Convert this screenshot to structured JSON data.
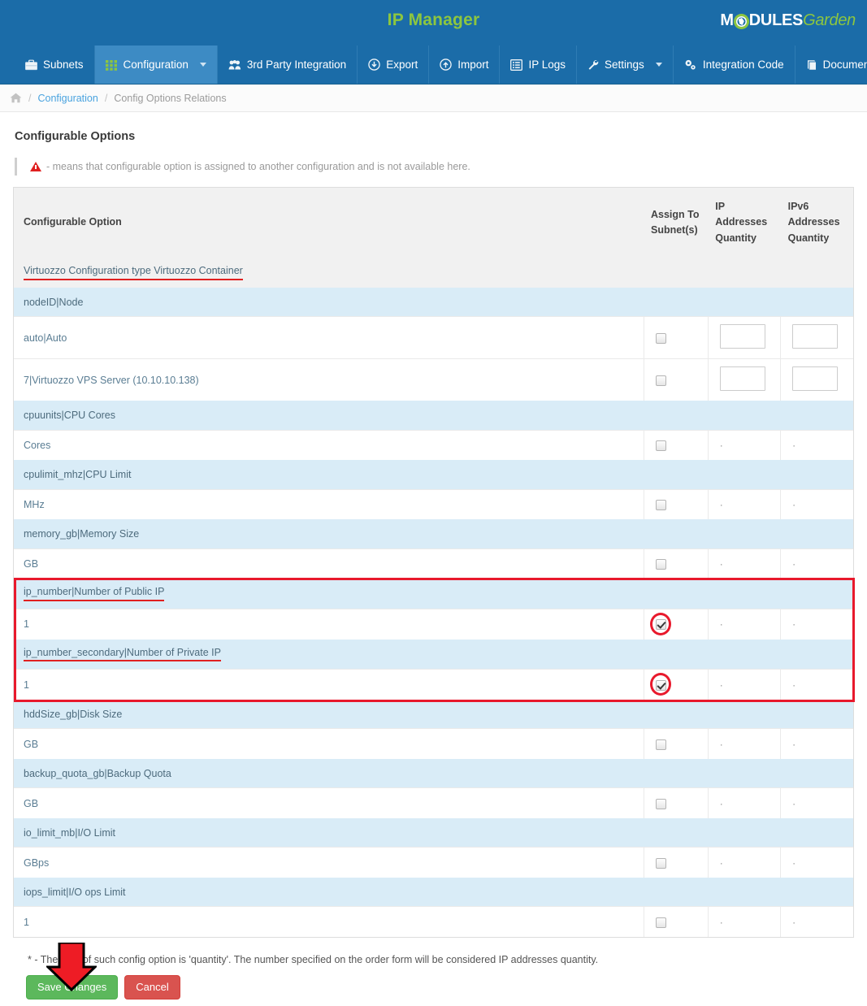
{
  "header": {
    "app_title": "IP Manager",
    "logo": {
      "part1": "M",
      "part2": "DULES",
      "part3": "Garden",
      "globe_icon": "globe-icon"
    },
    "brand_color": "#8dc63f",
    "bar_color": "#1b6ca8"
  },
  "nav": {
    "items": [
      {
        "label": "Subnets",
        "icon": "briefcase-icon",
        "active": false,
        "caret": false
      },
      {
        "label": "Configuration",
        "icon": "grid-icon",
        "active": true,
        "caret": true
      },
      {
        "label": "3rd Party Integration",
        "icon": "users-icon",
        "active": false,
        "caret": false
      },
      {
        "label": "Export",
        "icon": "download-circle-icon",
        "active": false,
        "caret": false
      },
      {
        "label": "Import",
        "icon": "upload-circle-icon",
        "active": false,
        "caret": false
      },
      {
        "label": "IP Logs",
        "icon": "list-icon",
        "active": false,
        "caret": false
      },
      {
        "label": "Settings",
        "icon": "wrench-icon",
        "active": false,
        "caret": true
      },
      {
        "label": "Integration Code",
        "icon": "gears-icon",
        "active": false,
        "caret": false
      },
      {
        "label": "Documentation",
        "icon": "book-icon",
        "active": false,
        "caret": false
      }
    ]
  },
  "breadcrumb": {
    "home_icon": "home-icon",
    "sep": "/",
    "link": "Configuration",
    "current": "Config Options Relations"
  },
  "main": {
    "page_title": "Configurable Options",
    "note": "- means that configurable option is assigned to another configuration and is not available here.",
    "note_icon": "warning-triangle-icon",
    "footnote": "* - The type of such config option is 'quantity'. The number specified on the order form will be considered IP addresses quantity.",
    "save_label": "Save Changes",
    "cancel_label": "Cancel"
  },
  "table": {
    "headers": {
      "option": "Configurable Option",
      "assign": "Assign To Subnet(s)",
      "ip_qty": "IP Addresses Quantity",
      "ipv6_qty": "IPv6 Addresses Quantity"
    },
    "rows": [
      {
        "kind": "group",
        "style": "plain",
        "label": "Virtuozzo Configuration type Virtuozzo Container",
        "underline": true
      },
      {
        "kind": "group",
        "style": "blue",
        "label": "nodeID|Node",
        "underline": false
      },
      {
        "kind": "option",
        "label": "auto|Auto",
        "checked": false,
        "circled": false,
        "ip": "input",
        "ipv6": "input",
        "tall": true
      },
      {
        "kind": "option",
        "label": "7|Virtuozzo VPS Server (10.10.10.138)",
        "checked": false,
        "circled": false,
        "ip": "input",
        "ipv6": "input",
        "tall": true
      },
      {
        "kind": "group",
        "style": "blue",
        "label": "cpuunits|CPU Cores",
        "underline": false
      },
      {
        "kind": "option",
        "label": "Cores",
        "checked": false,
        "circled": false,
        "ip": "·",
        "ipv6": "·",
        "tall": false
      },
      {
        "kind": "group",
        "style": "blue",
        "label": "cpulimit_mhz|CPU Limit",
        "underline": false
      },
      {
        "kind": "option",
        "label": "MHz",
        "checked": false,
        "circled": false,
        "ip": "·",
        "ipv6": "·",
        "tall": false
      },
      {
        "kind": "group",
        "style": "blue",
        "label": "memory_gb|Memory Size",
        "underline": false
      },
      {
        "kind": "option",
        "label": "GB",
        "checked": false,
        "circled": false,
        "ip": "·",
        "ipv6": "·",
        "tall": false
      },
      {
        "kind": "group",
        "style": "blue",
        "label": "ip_number|Number of Public IP",
        "underline": true
      },
      {
        "kind": "option",
        "label": "1",
        "checked": true,
        "circled": true,
        "ip": "·",
        "ipv6": "·",
        "tall": false
      },
      {
        "kind": "group",
        "style": "blue",
        "label": "ip_number_secondary|Number of Private IP",
        "underline": true
      },
      {
        "kind": "option",
        "label": "1",
        "checked": true,
        "circled": true,
        "ip": "·",
        "ipv6": "·",
        "tall": false
      },
      {
        "kind": "group",
        "style": "blue",
        "label": "hddSize_gb|Disk Size",
        "underline": false
      },
      {
        "kind": "option",
        "label": "GB",
        "checked": false,
        "circled": false,
        "ip": "·",
        "ipv6": "·",
        "tall": false
      },
      {
        "kind": "group",
        "style": "blue",
        "label": "backup_quota_gb|Backup Quota",
        "underline": false
      },
      {
        "kind": "option",
        "label": "GB",
        "checked": false,
        "circled": false,
        "ip": "·",
        "ipv6": "·",
        "tall": false
      },
      {
        "kind": "group",
        "style": "blue",
        "label": "io_limit_mb|I/O Limit",
        "underline": false
      },
      {
        "kind": "option",
        "label": "GBps",
        "checked": false,
        "circled": false,
        "ip": "·",
        "ipv6": "·",
        "tall": false
      },
      {
        "kind": "group",
        "style": "blue",
        "label": "iops_limit|I/O ops Limit",
        "underline": false
      },
      {
        "kind": "option",
        "label": "1",
        "checked": false,
        "circled": false,
        "ip": "·",
        "ipv6": "·",
        "tall": false
      }
    ]
  },
  "annotations": {
    "highlight_color": "#e8192c",
    "arrow_color": "#e8192c",
    "arrow_name": "red-down-arrow-annotation",
    "highlight_box_name": "red-highlight-box-annotation"
  }
}
